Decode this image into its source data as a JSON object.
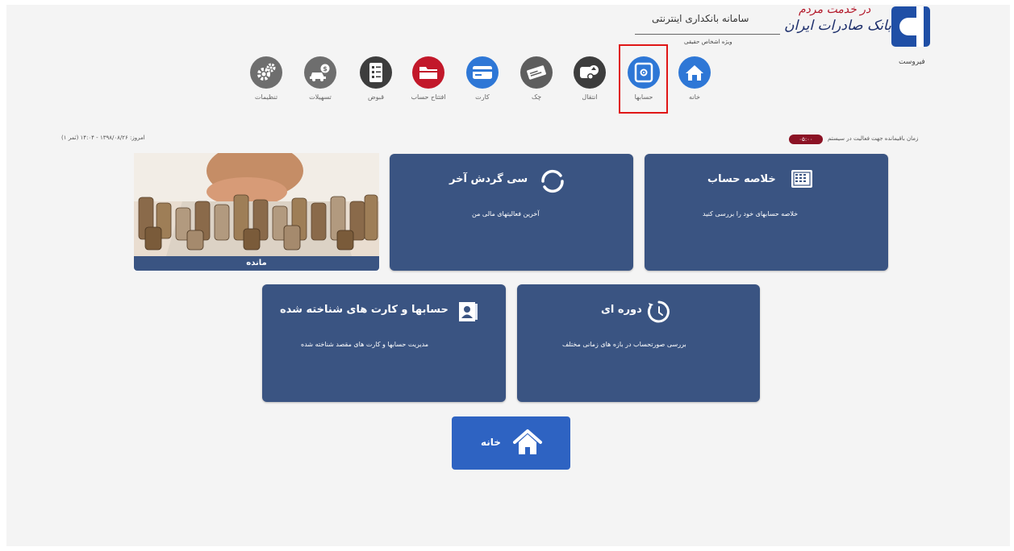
{
  "header": {
    "brand_name": "بانک صادرات ایران",
    "slogan": "در خدمت مردم",
    "system_title": "سامانه بانکداری اینترنتی",
    "system_subtitle": "ویژه اشخاص حقیقی",
    "user_name": "فیروست"
  },
  "status": {
    "datetime": "امروز: ۱۳۹۸/۰۸/۲۶ - ۱۴:۰۴ (ثمر ۱)",
    "session_time": "۰۵:۰۰",
    "session_label": "زمان باقیمانده جهت فعالیت در سیستم"
  },
  "nav": {
    "items": [
      {
        "label": "خانه",
        "icon": "home-icon",
        "color": "#2e77d6"
      },
      {
        "label": "حسابها",
        "icon": "safe-icon",
        "color": "#2e77d6",
        "active": true
      },
      {
        "label": "انتقال",
        "icon": "transfer-icon",
        "color": "#3d3d3d"
      },
      {
        "label": "چک",
        "icon": "check-icon",
        "color": "#5e5e5e"
      },
      {
        "label": "کارت",
        "icon": "card-icon",
        "color": "#2e77d6"
      },
      {
        "label": "افتتاح حساب",
        "icon": "folder-icon",
        "color": "#c2182a"
      },
      {
        "label": "قبوض",
        "icon": "bill-icon",
        "color": "#3d3d3d"
      },
      {
        "label": "تسهیلات",
        "icon": "car-loan-icon",
        "color": "#6e6e6e"
      },
      {
        "label": "تنظیمات",
        "icon": "gear-icon",
        "color": "#6e6e6e"
      }
    ],
    "active_color": "#e01616"
  },
  "cards": {
    "summary": {
      "title": "خلاصه حساب",
      "desc": "خلاصه حسابهای خود را بررسی کنید"
    },
    "last_thirty": {
      "title": "سی گردش آخر",
      "desc": "آخرین فعالیتهای مالی من"
    },
    "balance": {
      "caption": "مانده"
    },
    "periodic": {
      "title": "دوره ای",
      "desc": "بررسی صورتحساب در بازه های زمانی مختلف"
    },
    "known_accounts": {
      "title": "حسابها و کارت های شناخته شده",
      "desc": "مدیریت حسابها و کارت های مقصد شناخته شده"
    },
    "home_button": {
      "label": "خانه"
    }
  },
  "colors": {
    "card": "#3a5482",
    "brand": "#1f4fa6",
    "home_button": "#2e63c2",
    "session_badge": "#8b1224"
  }
}
